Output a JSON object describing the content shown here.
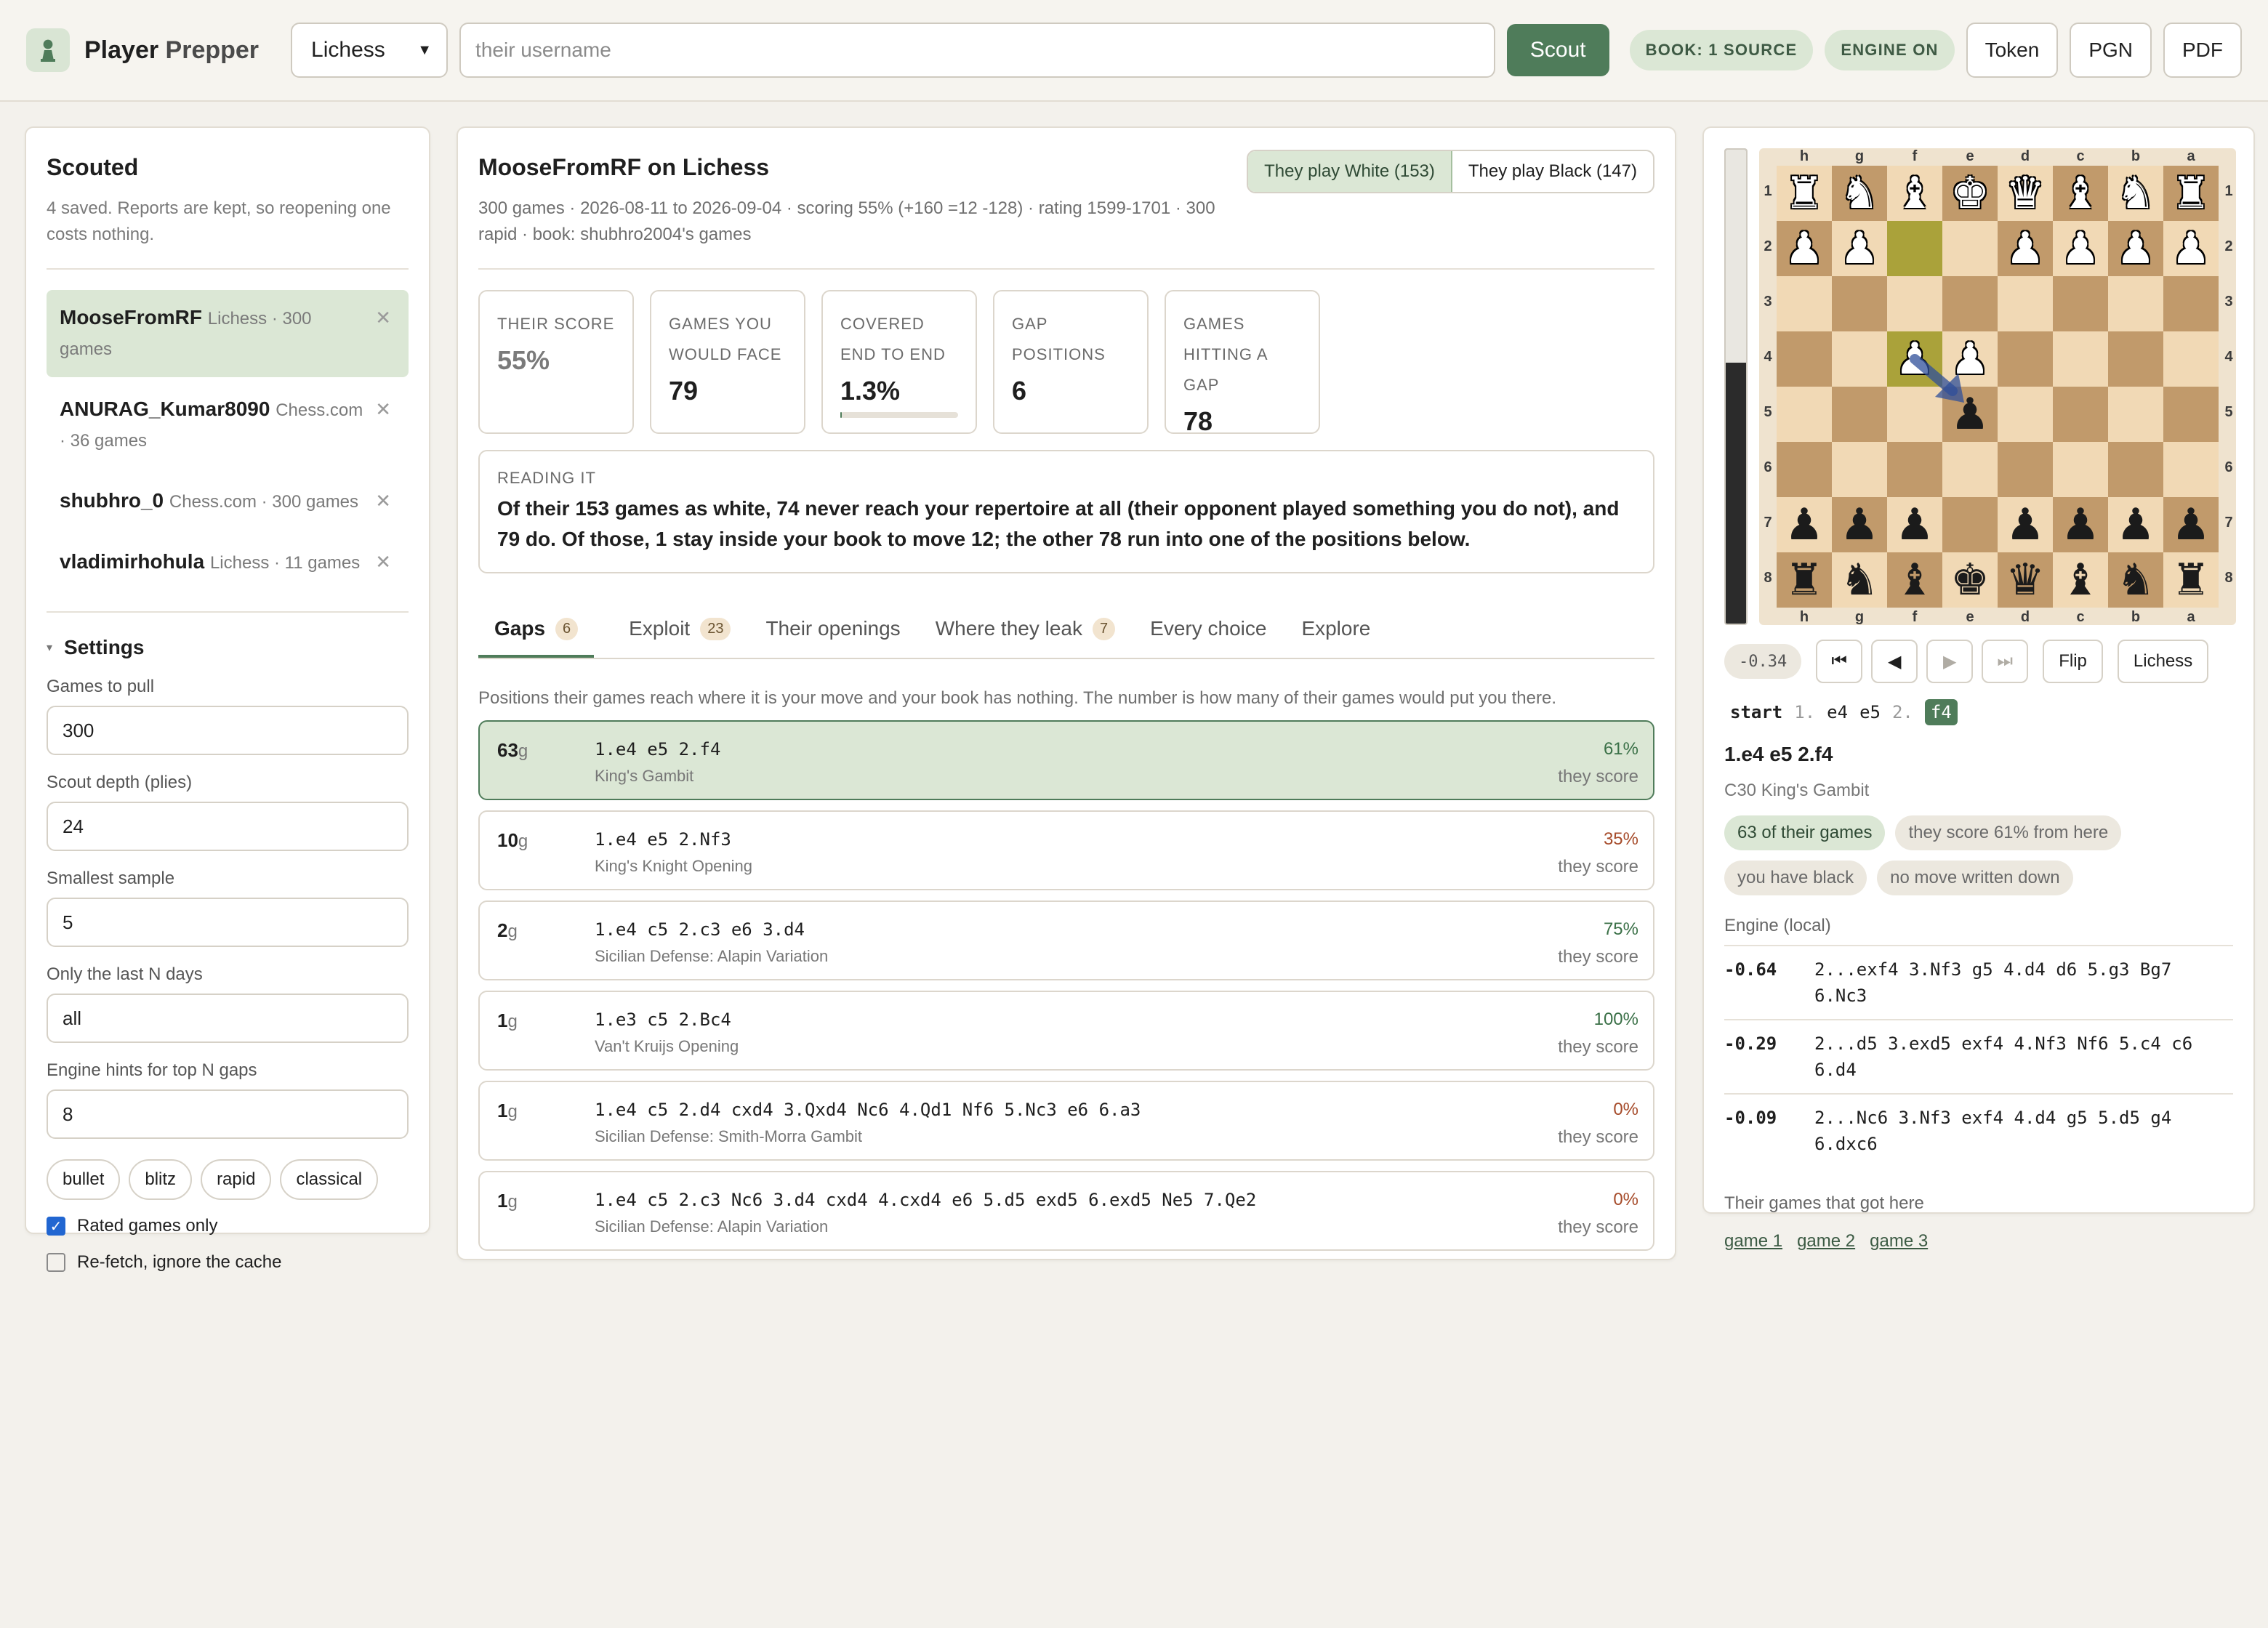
{
  "header": {
    "brand_main": "Player",
    "brand_sub": "Prepper",
    "site_select": "Lichess",
    "username_placeholder": "their username",
    "scout_label": "Scout",
    "book_badge": "BOOK: 1 SOURCE",
    "engine_badge": "ENGINE ON",
    "token_label": "Token",
    "pgn_label": "PGN",
    "pdf_label": "PDF"
  },
  "sidebar": {
    "title": "Scouted",
    "note": "4 saved. Reports are kept, so reopening one costs nothing.",
    "items": [
      {
        "name": "MooseFromRF",
        "meta": "Lichess · 300 games"
      },
      {
        "name": "ANURAG_Kumar8090",
        "meta": "Chess.com · 36 games"
      },
      {
        "name": "shubhro_0",
        "meta": "Chess.com · 300 games"
      },
      {
        "name": "vladimirhohula",
        "meta": "Lichess · 11 games"
      }
    ],
    "settings_title": "Settings",
    "fields": [
      {
        "label": "Games to pull",
        "value": "300"
      },
      {
        "label": "Scout depth (plies)",
        "value": "24"
      },
      {
        "label": "Smallest sample",
        "value": "5"
      },
      {
        "label": "Only the last N days",
        "value": "all"
      },
      {
        "label": "Engine hints for top N gaps",
        "value": "8"
      }
    ],
    "speeds": [
      "bullet",
      "blitz",
      "rapid",
      "classical"
    ],
    "rated_only": "Rated games only",
    "refetch": "Re-fetch, ignore the cache"
  },
  "report": {
    "title": "MooseFromRF on Lichess",
    "subtitle": "300 games · 2026-08-11 to 2026-09-04 · scoring 55% (+160 =12 -128) · rating 1599-1701 · 300 rapid · book: shubhro2004's games",
    "side_white": "They play White (153)",
    "side_black": "They play Black (147)",
    "stats": [
      {
        "label": "THEIR SCORE",
        "value": "55%"
      },
      {
        "label": "GAMES YOU WOULD FACE",
        "value": "79"
      },
      {
        "label": "COVERED END TO END",
        "value": "1.3%",
        "fraction": 0.013
      },
      {
        "label": "GAP POSITIONS",
        "value": "6"
      },
      {
        "label": "GAMES HITTING A GAP",
        "value": "78"
      }
    ],
    "reading_label": "READING IT",
    "reading_text": "Of their 153 games as white, 74 never reach your repertoire at all (their opponent played something you do not), and 79 do. Of those, 1 stay inside your book to move 12; the other 78 run into one of the positions below.",
    "tabs": [
      {
        "label": "Gaps",
        "badge": "6"
      },
      {
        "label": "Exploit",
        "badge": "23"
      },
      {
        "label": "Their openings",
        "badge": ""
      },
      {
        "label": "Where they leak",
        "badge": "7"
      },
      {
        "label": "Every choice",
        "badge": ""
      },
      {
        "label": "Explore",
        "badge": ""
      }
    ],
    "tab_desc": "Positions their games reach where it is your move and your book has nothing. The number is how many of their games would put you there.",
    "they_score": "they score",
    "gaps": [
      {
        "count": "63",
        "moves": "1.e4 e5 2.f4",
        "opening": "King's Gambit",
        "pct": "61%"
      },
      {
        "count": "10",
        "moves": "1.e4 e5 2.Nf3",
        "opening": "King's Knight Opening",
        "pct": "35%"
      },
      {
        "count": "2",
        "moves": "1.e4 c5 2.c3 e6 3.d4",
        "opening": "Sicilian Defense: Alapin Variation",
        "pct": "75%"
      },
      {
        "count": "1",
        "moves": "1.e3 c5 2.Bc4",
        "opening": "Van't Kruijs Opening",
        "pct": "100%"
      },
      {
        "count": "1",
        "moves": "1.e4 c5 2.d4 cxd4 3.Qxd4 Nc6 4.Qd1 Nf6 5.Nc3 e6 6.a3",
        "opening": "Sicilian Defense: Smith-Morra Gambit",
        "pct": "0%"
      },
      {
        "count": "1",
        "moves": "1.e4 c5 2.c3 Nc6 3.d4 cxd4 4.cxd4 e6 5.d5 exd5 6.exd5 Ne5 7.Qe2",
        "opening": "Sicilian Defense: Alapin Variation",
        "pct": "0%"
      }
    ]
  },
  "board": {
    "files": [
      "h",
      "g",
      "f",
      "e",
      "d",
      "c",
      "b",
      "a"
    ],
    "ranks": [
      "1",
      "2",
      "3",
      "4",
      "5",
      "6",
      "7",
      "8"
    ],
    "eval_white_fraction": 0.45,
    "rows": [
      [
        "R",
        "N",
        "B",
        "K",
        "Q",
        "B",
        "N",
        "R"
      ],
      [
        "P",
        "P",
        "",
        "",
        "P",
        "P",
        "P",
        "P"
      ],
      [
        "",
        "",
        "",
        "",
        "",
        "",
        "",
        ""
      ],
      [
        "",
        "",
        "P",
        "P",
        "",
        "",
        "",
        ""
      ],
      [
        "",
        "",
        "",
        "p",
        "",
        "",
        "",
        ""
      ],
      [
        "",
        "",
        "",
        "",
        "",
        "",
        "",
        ""
      ],
      [
        "p",
        "p",
        "p",
        "",
        "p",
        "p",
        "p",
        "p"
      ],
      [
        "r",
        "n",
        "b",
        "k",
        "q",
        "b",
        "n",
        "r"
      ]
    ],
    "eval_text": "-0.34",
    "flip_label": "Flip",
    "lichess_label": "Lichess",
    "moves": [
      "start",
      "1.",
      "e4",
      "e5",
      "2.",
      "f4"
    ],
    "line": "1.e4 e5 2.f4",
    "eco": "C30 King's Gambit",
    "tags": [
      "63 of their games",
      "they score 61% from here",
      "you have black",
      "no move written down"
    ],
    "engine_title": "Engine (local)",
    "engine_lines": [
      {
        "score": "-0.64",
        "pv": "2...exf4 3.Nf3 g5 4.d4 d6 5.g3 Bg7 6.Nc3"
      },
      {
        "score": "-0.29",
        "pv": "2...d5 3.exd5 exf4 4.Nf3 Nf6 5.c4 c6 6.d4"
      },
      {
        "score": "-0.09",
        "pv": "2...Nc6 3.Nf3 exf4 4.d4 g5 5.d5 g4 6.dxc6"
      }
    ],
    "games_title": "Their games that got here",
    "game_links": [
      "game 1",
      "game 2",
      "game 3"
    ]
  },
  "colors": {
    "accent": "#4f7c5a",
    "accent_light": "#dbe7d5",
    "light_sq": "#f1d9b5",
    "dark_sq": "#c19a6b",
    "highlight": "#aaa23a"
  }
}
